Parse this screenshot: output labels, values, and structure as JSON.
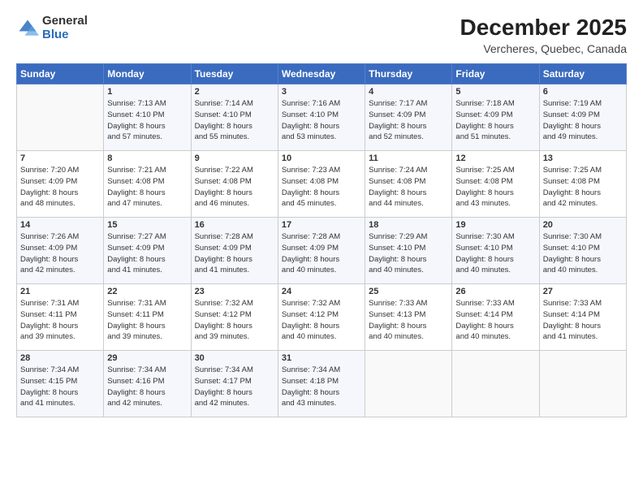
{
  "header": {
    "logo_general": "General",
    "logo_blue": "Blue",
    "title": "December 2025",
    "subtitle": "Vercheres, Quebec, Canada"
  },
  "days_of_week": [
    "Sunday",
    "Monday",
    "Tuesday",
    "Wednesday",
    "Thursday",
    "Friday",
    "Saturday"
  ],
  "weeks": [
    [
      {
        "day": "",
        "info": ""
      },
      {
        "day": "1",
        "info": "Sunrise: 7:13 AM\nSunset: 4:10 PM\nDaylight: 8 hours\nand 57 minutes."
      },
      {
        "day": "2",
        "info": "Sunrise: 7:14 AM\nSunset: 4:10 PM\nDaylight: 8 hours\nand 55 minutes."
      },
      {
        "day": "3",
        "info": "Sunrise: 7:16 AM\nSunset: 4:10 PM\nDaylight: 8 hours\nand 53 minutes."
      },
      {
        "day": "4",
        "info": "Sunrise: 7:17 AM\nSunset: 4:09 PM\nDaylight: 8 hours\nand 52 minutes."
      },
      {
        "day": "5",
        "info": "Sunrise: 7:18 AM\nSunset: 4:09 PM\nDaylight: 8 hours\nand 51 minutes."
      },
      {
        "day": "6",
        "info": "Sunrise: 7:19 AM\nSunset: 4:09 PM\nDaylight: 8 hours\nand 49 minutes."
      }
    ],
    [
      {
        "day": "7",
        "info": "Sunrise: 7:20 AM\nSunset: 4:09 PM\nDaylight: 8 hours\nand 48 minutes."
      },
      {
        "day": "8",
        "info": "Sunrise: 7:21 AM\nSunset: 4:08 PM\nDaylight: 8 hours\nand 47 minutes."
      },
      {
        "day": "9",
        "info": "Sunrise: 7:22 AM\nSunset: 4:08 PM\nDaylight: 8 hours\nand 46 minutes."
      },
      {
        "day": "10",
        "info": "Sunrise: 7:23 AM\nSunset: 4:08 PM\nDaylight: 8 hours\nand 45 minutes."
      },
      {
        "day": "11",
        "info": "Sunrise: 7:24 AM\nSunset: 4:08 PM\nDaylight: 8 hours\nand 44 minutes."
      },
      {
        "day": "12",
        "info": "Sunrise: 7:25 AM\nSunset: 4:08 PM\nDaylight: 8 hours\nand 43 minutes."
      },
      {
        "day": "13",
        "info": "Sunrise: 7:25 AM\nSunset: 4:08 PM\nDaylight: 8 hours\nand 42 minutes."
      }
    ],
    [
      {
        "day": "14",
        "info": "Sunrise: 7:26 AM\nSunset: 4:09 PM\nDaylight: 8 hours\nand 42 minutes."
      },
      {
        "day": "15",
        "info": "Sunrise: 7:27 AM\nSunset: 4:09 PM\nDaylight: 8 hours\nand 41 minutes."
      },
      {
        "day": "16",
        "info": "Sunrise: 7:28 AM\nSunset: 4:09 PM\nDaylight: 8 hours\nand 41 minutes."
      },
      {
        "day": "17",
        "info": "Sunrise: 7:28 AM\nSunset: 4:09 PM\nDaylight: 8 hours\nand 40 minutes."
      },
      {
        "day": "18",
        "info": "Sunrise: 7:29 AM\nSunset: 4:10 PM\nDaylight: 8 hours\nand 40 minutes."
      },
      {
        "day": "19",
        "info": "Sunrise: 7:30 AM\nSunset: 4:10 PM\nDaylight: 8 hours\nand 40 minutes."
      },
      {
        "day": "20",
        "info": "Sunrise: 7:30 AM\nSunset: 4:10 PM\nDaylight: 8 hours\nand 40 minutes."
      }
    ],
    [
      {
        "day": "21",
        "info": "Sunrise: 7:31 AM\nSunset: 4:11 PM\nDaylight: 8 hours\nand 39 minutes."
      },
      {
        "day": "22",
        "info": "Sunrise: 7:31 AM\nSunset: 4:11 PM\nDaylight: 8 hours\nand 39 minutes."
      },
      {
        "day": "23",
        "info": "Sunrise: 7:32 AM\nSunset: 4:12 PM\nDaylight: 8 hours\nand 39 minutes."
      },
      {
        "day": "24",
        "info": "Sunrise: 7:32 AM\nSunset: 4:12 PM\nDaylight: 8 hours\nand 40 minutes."
      },
      {
        "day": "25",
        "info": "Sunrise: 7:33 AM\nSunset: 4:13 PM\nDaylight: 8 hours\nand 40 minutes."
      },
      {
        "day": "26",
        "info": "Sunrise: 7:33 AM\nSunset: 4:14 PM\nDaylight: 8 hours\nand 40 minutes."
      },
      {
        "day": "27",
        "info": "Sunrise: 7:33 AM\nSunset: 4:14 PM\nDaylight: 8 hours\nand 41 minutes."
      }
    ],
    [
      {
        "day": "28",
        "info": "Sunrise: 7:34 AM\nSunset: 4:15 PM\nDaylight: 8 hours\nand 41 minutes."
      },
      {
        "day": "29",
        "info": "Sunrise: 7:34 AM\nSunset: 4:16 PM\nDaylight: 8 hours\nand 42 minutes."
      },
      {
        "day": "30",
        "info": "Sunrise: 7:34 AM\nSunset: 4:17 PM\nDaylight: 8 hours\nand 42 minutes."
      },
      {
        "day": "31",
        "info": "Sunrise: 7:34 AM\nSunset: 4:18 PM\nDaylight: 8 hours\nand 43 minutes."
      },
      {
        "day": "",
        "info": ""
      },
      {
        "day": "",
        "info": ""
      },
      {
        "day": "",
        "info": ""
      }
    ]
  ]
}
